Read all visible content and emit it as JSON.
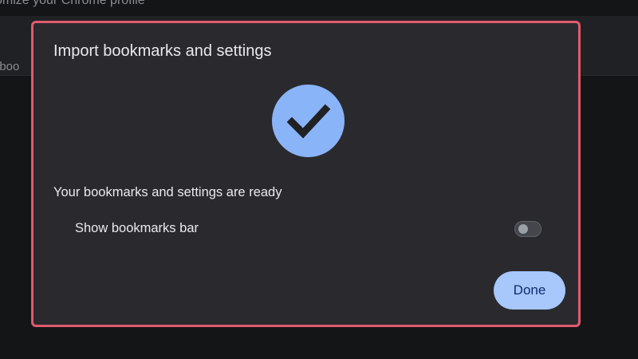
{
  "background": {
    "heading": "omize your Chrome profile",
    "label": "rt boo"
  },
  "dialog": {
    "title": "Import bookmarks and settings",
    "status_icon": "checkmark-icon",
    "status_text": "Your bookmarks and settings are ready",
    "toggle": {
      "label": "Show bookmarks bar",
      "enabled": false
    },
    "done_label": "Done"
  },
  "colors": {
    "dialog_bg": "#2a2a2e",
    "highlight_border": "#e05a6d",
    "accent": "#8ab4f8",
    "button_bg": "#a8c7fa",
    "button_text": "#0b2e6e"
  }
}
